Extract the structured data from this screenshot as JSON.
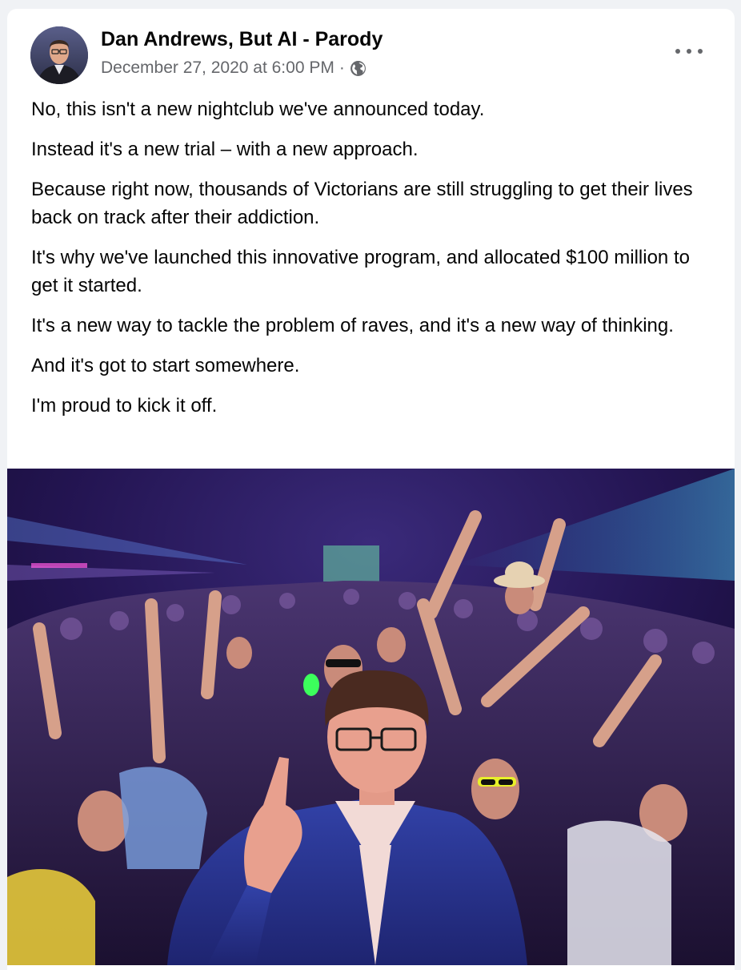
{
  "post": {
    "author": "Dan Andrews, But AI - Parody",
    "timestamp": "December 27, 2020 at 6:00 PM",
    "separator": "·",
    "audience_icon": "globe-icon",
    "more_icon": "more-options-icon",
    "paragraphs": [
      "No, this isn't a new nightclub we've announced today.",
      "Instead it's a new trial – with a new approach.",
      "Because right now, thousands of Victorians are still struggling to get their lives back on track after their addiction.",
      "It's why we've launched this innovative program, and allocated $100 million to get it started.",
      "It's a new way to tackle the problem of raves, and it's a new way of thinking.",
      "And it's got to start somewhere.",
      "I'm proud to kick it off."
    ]
  },
  "colors": {
    "text_primary": "#050505",
    "text_secondary": "#65676b",
    "page_bg": "#f0f2f5",
    "card_bg": "#ffffff"
  }
}
